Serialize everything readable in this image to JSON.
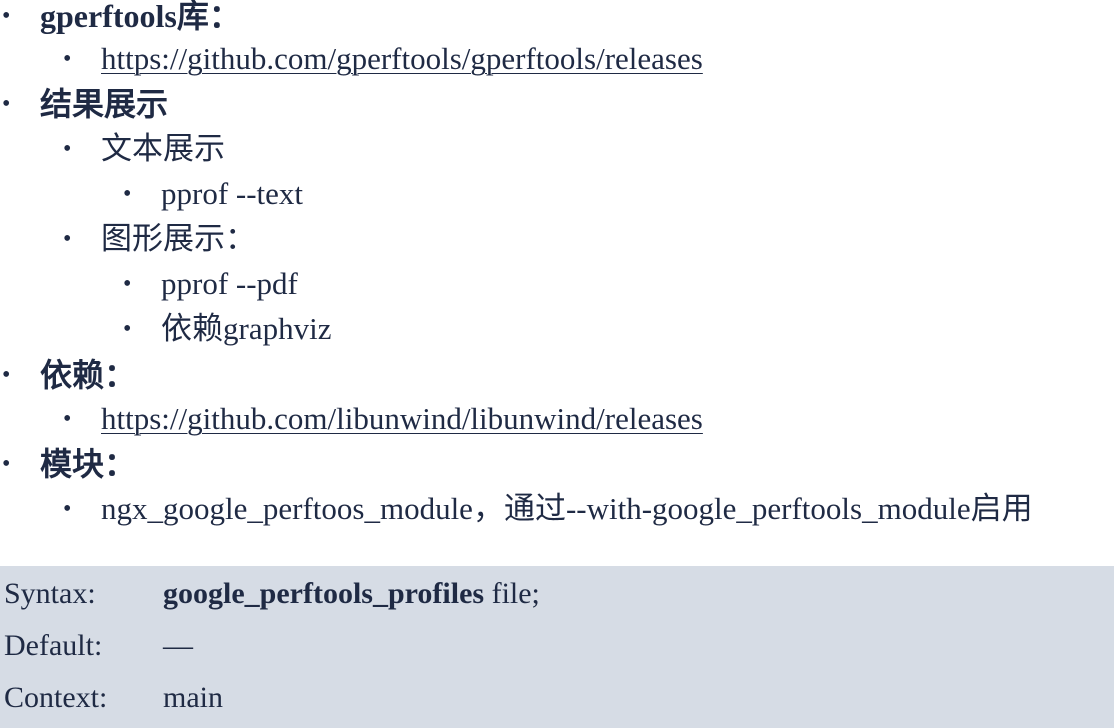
{
  "outline": {
    "gperftools": {
      "title": "gperftools库：",
      "link": "https://github.com/gperftools/gperftools/releases"
    },
    "result": {
      "title": "结果展示",
      "text_view": {
        "label": "文本展示",
        "cmd": "pprof --text"
      },
      "graph_view": {
        "label": "图形展示：",
        "cmd": "pprof --pdf",
        "dep": "依赖graphviz"
      }
    },
    "depends": {
      "title": "依赖：",
      "link": "https://github.com/libunwind/libunwind/releases"
    },
    "module": {
      "title": "模块：",
      "desc": "ngx_google_perftoos_module，通过--with-google_perftools_module启用"
    }
  },
  "bullet_char": "•",
  "directive": {
    "syntax_label": "Syntax:",
    "syntax_name": "google_perftools_profiles",
    "syntax_arg": " file;",
    "default_label": "Default:",
    "default_value": "—",
    "context_label": "Context:",
    "context_value": "main"
  }
}
